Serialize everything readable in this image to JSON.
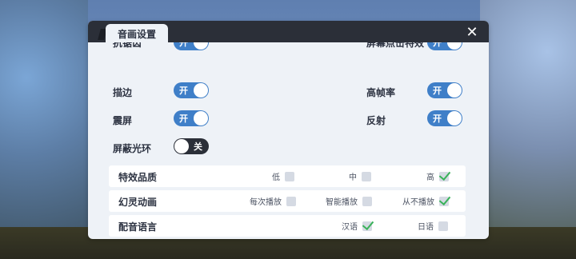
{
  "dialog": {
    "tab_title": "音画设置",
    "close_symbol": "✕"
  },
  "toggles": [
    {
      "label": "抗锯齿",
      "state_label": "开",
      "on": true
    },
    {
      "label": "屏幕点击特效",
      "state_label": "开",
      "on": true
    },
    {
      "label": "描边",
      "state_label": "开",
      "on": true
    },
    {
      "label": "高帧率",
      "state_label": "开",
      "on": true
    },
    {
      "label": "震屏",
      "state_label": "开",
      "on": true
    },
    {
      "label": "反射",
      "state_label": "开",
      "on": true
    },
    {
      "label": "屏蔽光环",
      "state_label": "关",
      "on": false
    }
  ],
  "options": [
    {
      "label": "特效品质",
      "choices": [
        {
          "text": "低",
          "checked": false
        },
        {
          "text": "中",
          "checked": false
        },
        {
          "text": "高",
          "checked": true
        }
      ]
    },
    {
      "label": "幻灵动画",
      "choices": [
        {
          "text": "每次播放",
          "checked": false
        },
        {
          "text": "智能播放",
          "checked": false
        },
        {
          "text": "从不播放",
          "checked": true
        }
      ]
    },
    {
      "label": "配音语言",
      "choices": [
        {
          "text": "汉语",
          "checked": true
        },
        {
          "text": "日语",
          "checked": false
        }
      ]
    }
  ],
  "colors": {
    "toggle_on": "#3f7fc8",
    "toggle_off": "#2b2f38",
    "check": "#3ab25a",
    "header": "#2b2f38"
  }
}
